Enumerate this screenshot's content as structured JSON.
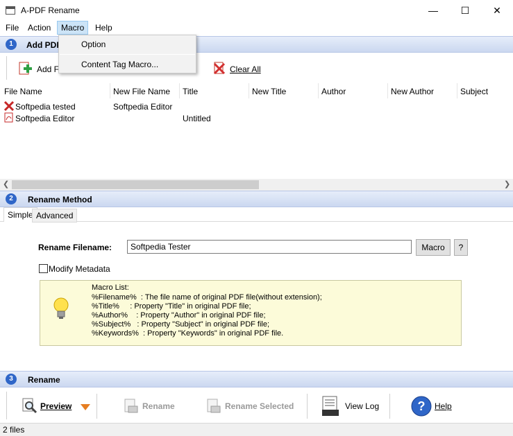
{
  "window": {
    "title": "A-PDF Rename",
    "minimize": "—",
    "maximize": "☐",
    "close": "✕"
  },
  "menubar": [
    "File",
    "Action",
    "Macro",
    "Help"
  ],
  "dropdown": [
    "Option",
    "Content Tag Macro..."
  ],
  "section1": {
    "number": "1",
    "title": "Add PDF"
  },
  "toolbar1": {
    "add": "Add F",
    "clear_all": "Clear All"
  },
  "columns": [
    "File Name",
    "New File Name",
    "Title",
    "New Title",
    "Author",
    "New Author",
    "Subject"
  ],
  "files": [
    {
      "name": "Softpedia tested",
      "new_name": "Softpedia Editor",
      "title": ""
    },
    {
      "name": "Softpedia Editor",
      "new_name": "",
      "title": "Untitled"
    }
  ],
  "section2": {
    "number": "2",
    "title": "Rename Method"
  },
  "tabs": [
    "Simple",
    "Advanced"
  ],
  "rename_filename": {
    "label": "Rename Filename:",
    "value": "Softpedia Tester",
    "macro_button": "Macro",
    "help_button": "?"
  },
  "modify_metadata": {
    "label": "Modify Metadata",
    "checked": false
  },
  "macro_list": {
    "heading": "Macro List:",
    "lines": [
      "%Filename%  : The file name of original PDF file(without extension);",
      "%Title%     : Property \"Title\" in original PDF file;",
      "%Author%    : Property \"Author\" in original PDF file;",
      "%Subject%   : Property \"Subject\" in original PDF file;",
      "%Keywords%  : Property \"Keywords\" in original PDF file."
    ]
  },
  "section3": {
    "number": "3",
    "title": "Rename"
  },
  "toolbar3": {
    "preview": "Preview",
    "rename": "Rename",
    "rename_selected": "Rename Selected",
    "view_log": "View Log",
    "help": "Help"
  },
  "status": "2 files",
  "colors": {
    "section_accent": "#2f66c8",
    "macro_box": "#fcfbd9",
    "menu_highlight": "#cce4f7"
  }
}
